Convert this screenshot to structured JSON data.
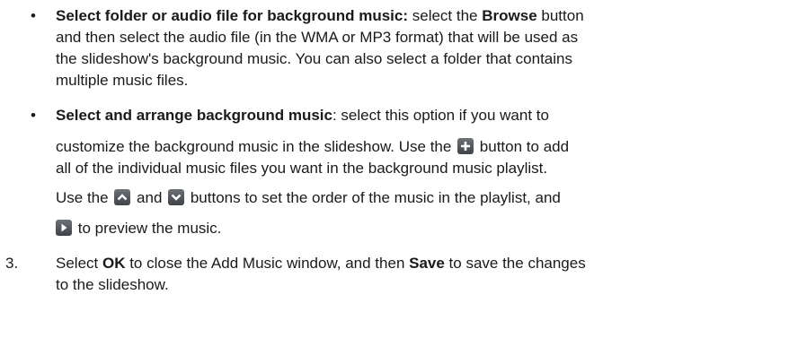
{
  "items": [
    {
      "marker": "•",
      "lead": "Select folder or audio file for background music:",
      "lines": [
        " select the ",
        "Browse",
        " button",
        "and then select the audio file (in the WMA or MP3 format) that will be used as",
        "the slideshow's background music. You can also select a folder that contains",
        "multiple music files."
      ]
    },
    {
      "marker": "•",
      "lead": "Select and arrange background music",
      "l1_rest": ": select this option if you want to",
      "l2a": "customize the background music in the slideshow. Use the ",
      "l2b": " button to add",
      "l3": "all of the individual music files you want in the background music playlist.",
      "l4a": "Use the ",
      "l4b": " and ",
      "l4c": " buttons to set the order of the music in the playlist, and",
      "l5": " to preview the music."
    }
  ],
  "step3": {
    "number": "3.",
    "t1": "Select ",
    "ok": "OK",
    "t2": " to close the Add Music window, and then ",
    "save": "Save",
    "t3": " to save the changes",
    "l2": "to the slideshow."
  },
  "icons": {
    "add": "plus-icon",
    "up": "chevron-up-icon",
    "down": "chevron-down-icon",
    "play": "play-icon",
    "color": "#50555b"
  }
}
